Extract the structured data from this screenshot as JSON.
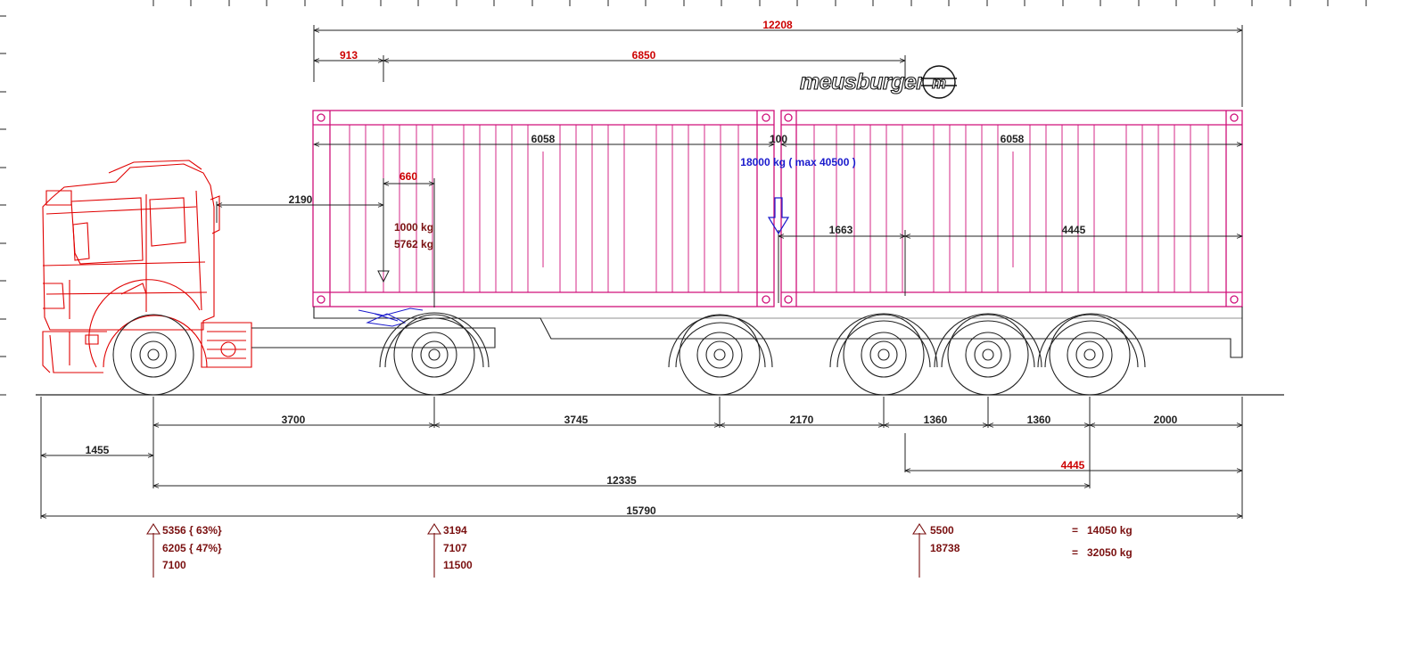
{
  "colors": {
    "line": "#222222",
    "truck": "#e00000",
    "container": "#d0107a",
    "dimension_red": "#cc0000",
    "load_text": "#7a1010",
    "load_blue": "#1a1acc"
  },
  "logo": {
    "text": "meusburger",
    "symbol": "m"
  },
  "top_dimensions": {
    "overall": "12208",
    "kingpin_offset": "913",
    "kingpin_to_load": "6850"
  },
  "containers": {
    "left_length": "6058",
    "gap": "100",
    "right_length": "6058",
    "load_label": "18000 kg ( max 40500 )"
  },
  "tractor_dims": {
    "cab_to_load": "2190",
    "fifth_wheel_offset": "660",
    "load_1": "1000 kg",
    "load_2": "5762 kg"
  },
  "trailer_dims": {
    "left": "1663",
    "right": "4445"
  },
  "bottom_dimensions": {
    "overhang_front": "1455",
    "wheelbase": "3700",
    "kingpin_to_axle": "3745",
    "axle_spacing_1": "2170",
    "axle_spacing_2": "1360",
    "axle_spacing_3": "1360",
    "rear_overhang": "2000",
    "trailer_load_center": "4445",
    "total_wheelbase": "12335",
    "overall_length": "15790"
  },
  "axle_loads": {
    "front": [
      "5356 { 63%}",
      "6205 { 47%}",
      "7100"
    ],
    "drive": [
      "3194",
      "7107",
      "11500"
    ],
    "trailer": [
      "5500",
      "18738"
    ],
    "totals": [
      "=   14050 kg",
      "=   32050 kg"
    ]
  }
}
